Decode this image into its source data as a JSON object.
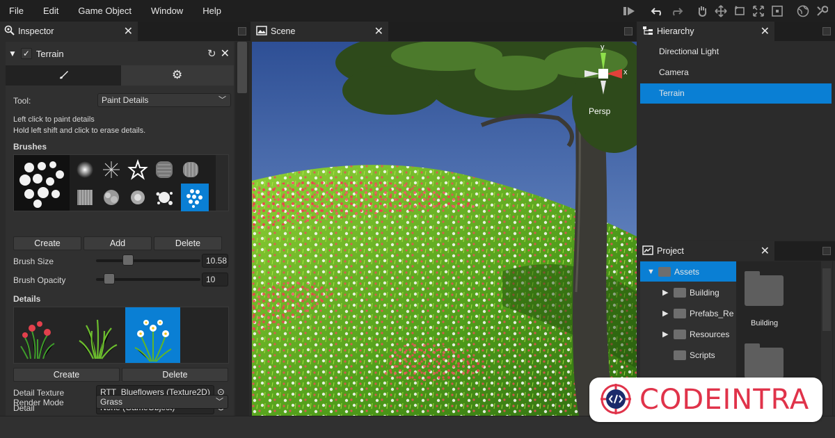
{
  "menubar": {
    "items": [
      "File",
      "Edit",
      "Game Object",
      "Window",
      "Help"
    ]
  },
  "toolbar": {
    "icons": [
      "play-icon",
      "undo-icon",
      "redo-icon",
      "hand-icon",
      "move-icon",
      "rotate-icon",
      "scale-icon",
      "rect-icon",
      "globe-icon",
      "wrench-icon"
    ]
  },
  "inspector": {
    "tab_title": "Inspector",
    "component_title": "Terrain",
    "tool_label": "Tool:",
    "tool_value": "Paint Details",
    "help_line1": "Left click to paint details",
    "help_line2": "Hold left shift and click to erase details.",
    "brushes_heading": "Brushes",
    "brush_buttons": [
      "Create",
      "Add",
      "Delete"
    ],
    "brush_size_label": "Brush Size",
    "brush_size_value": "10.58",
    "brush_size_fraction": 0.28,
    "brush_opacity_label": "Brush Opacity",
    "brush_opacity_value": "10",
    "brush_opacity_fraction": 0.08,
    "details_heading": "Details",
    "detail_buttons": [
      "Create",
      "Delete"
    ],
    "detail_texture_label": "Detail Texture",
    "detail_texture_value": "RTT_Blueflowers (Texture2D)",
    "detail_label": "Detail",
    "detail_value": "None (GameObject)",
    "render_mode_label": "Render Mode",
    "render_mode_value": "Grass"
  },
  "scene": {
    "tab_title": "Scene",
    "gizmo_label": "Persp",
    "axis_y": "y",
    "axis_x": "x"
  },
  "hierarchy": {
    "tab_title": "Hierarchy",
    "items": [
      {
        "label": "Directional Light",
        "selected": false
      },
      {
        "label": "Camera",
        "selected": false
      },
      {
        "label": "Terrain",
        "selected": true
      }
    ]
  },
  "project": {
    "tab_title": "Project",
    "tree": [
      {
        "label": "Assets",
        "depth": 0,
        "expanded": true,
        "selected": true
      },
      {
        "label": "Building",
        "depth": 1,
        "expanded": false
      },
      {
        "label": "Prefabs_Re",
        "depth": 1,
        "expanded": false
      },
      {
        "label": "Resources",
        "depth": 1,
        "expanded": false
      },
      {
        "label": "Scripts",
        "depth": 1,
        "leaf": true
      }
    ],
    "grid_items": [
      "Building"
    ]
  },
  "watermark": {
    "text": "CODEINTRA"
  },
  "colors": {
    "accent": "#0a7fd4",
    "panel": "#2b2b2b",
    "menubar": "#1f1f1f",
    "watermark": "#e0334a"
  }
}
